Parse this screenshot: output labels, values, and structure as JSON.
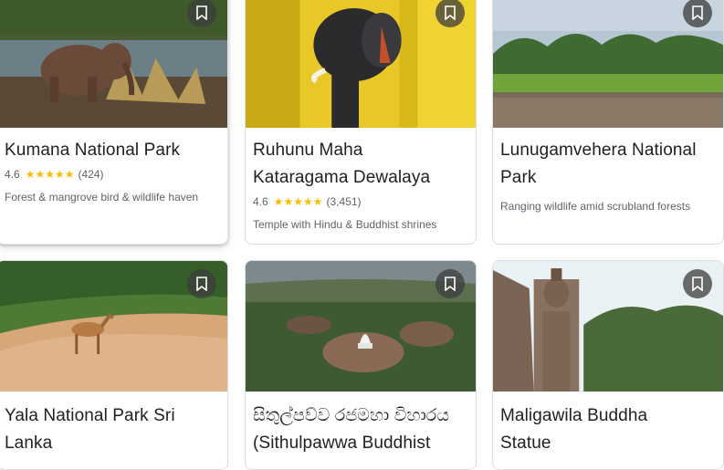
{
  "cards": [
    {
      "title": "Kumana National Park",
      "rating": "4.6",
      "reviews": "(424)",
      "description": "Forest & mangrove bird & wildlife haven"
    },
    {
      "title_line1": "Ruhunu Maha",
      "title_line2": "Kataragama Dewalaya",
      "rating": "4.6",
      "reviews": "(3,451)",
      "description": "Temple with Hindu & Buddhist shrines"
    },
    {
      "title_line1": "Lunugamvehera National",
      "title_line2": "Park",
      "description": "Ranging wildlife amid scrubland forests"
    },
    {
      "title_line1": "Yala National Park Sri",
      "title_line2": "Lanka"
    },
    {
      "title_line1": "සිතුල්පව්ව රජමහා විහාරය",
      "title_line2": "(Sithulpawwa Buddhist"
    },
    {
      "title_line1": "Maligawila Buddha",
      "title_line2": "Statue"
    }
  ],
  "icons": {
    "save": "bookmark-icon",
    "star": "star-icon"
  },
  "colors": {
    "star": "#fbbc04",
    "title": "#202124",
    "secondary": "#5f6368"
  }
}
